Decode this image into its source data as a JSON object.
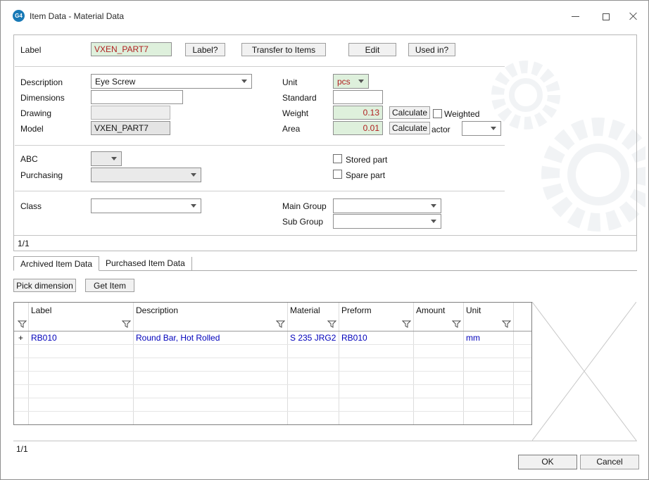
{
  "window": {
    "title": "Item Data - Material Data",
    "icon_text": "G4"
  },
  "label_section": {
    "label": "Label",
    "value": "VXEN_PART7",
    "label_button": "Label?",
    "transfer_button": "Transfer to Items",
    "edit_button": "Edit",
    "used_in_button": "Used in?"
  },
  "form": {
    "description": {
      "label": "Description",
      "value": "Eye Screw"
    },
    "dimensions": {
      "label": "Dimensions",
      "value": ""
    },
    "drawing": {
      "label": "Drawing",
      "value": ""
    },
    "model": {
      "label": "Model",
      "value": "VXEN_PART7"
    },
    "unit": {
      "label": "Unit",
      "value": "pcs"
    },
    "standard": {
      "label": "Standard",
      "value": ""
    },
    "weight": {
      "label": "Weight",
      "value": "0.13"
    },
    "area": {
      "label": "Area",
      "value": "0.01"
    },
    "calculate_button": "Calculate",
    "weighted_checkbox": "Weighted",
    "factor": {
      "label": "actor",
      "value": ""
    },
    "abc": {
      "label": "ABC",
      "value": ""
    },
    "purchasing": {
      "label": "Purchasing",
      "value": ""
    },
    "stored_part_checkbox": "Stored part",
    "spare_part_checkbox": "Spare part",
    "class": {
      "label": "Class",
      "value": ""
    },
    "main_group": {
      "label": "Main Group",
      "value": ""
    },
    "sub_group": {
      "label": "Sub Group",
      "value": ""
    },
    "pager": "1/1"
  },
  "tabs": [
    {
      "label": "Archived Item Data",
      "active": true
    },
    {
      "label": "Purchased Item Data",
      "active": false
    }
  ],
  "actions": {
    "pick_dimension_button": "Pick dimension",
    "get_item_button": "Get Item"
  },
  "grid": {
    "columns": [
      "Label",
      "Description",
      "Material",
      "Preform",
      "Amount",
      "Unit"
    ],
    "rows": [
      {
        "expand": "+",
        "label": "RB010",
        "description": "Round Bar, Hot Rolled",
        "material": "S 235 JRG2",
        "preform": "RB010",
        "amount": "",
        "unit": "mm"
      }
    ],
    "pager": "1/1"
  },
  "footer": {
    "ok_button": "OK",
    "cancel_button": "Cancel"
  },
  "colors": {
    "field_green": "#def0dc",
    "value_red": "#b02020",
    "grid_link_blue": "#0000bb",
    "app_icon_blue": "#1879b6"
  }
}
